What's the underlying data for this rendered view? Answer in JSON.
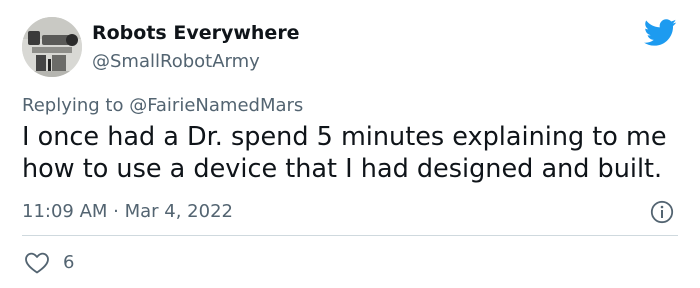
{
  "author": {
    "display_name": "Robots Everywhere",
    "handle": "@SmallRobotArmy",
    "avatar_icon": "robot-photo-avatar"
  },
  "reply": {
    "prefix": "Replying to ",
    "mention": "@FairieNamedMars"
  },
  "tweet": {
    "text": "I once had a Dr. spend 5 minutes explaining to me how to use a device that I had designed and built.",
    "timestamp": "11:09 AM · Mar 4, 2022"
  },
  "actions": {
    "like_count": "6",
    "like_icon": "heart-icon",
    "info_icon": "info-icon"
  },
  "brand": {
    "logo_icon": "twitter-bird-icon",
    "accent_color": "#1d9bf0",
    "secondary_text_color": "#536471",
    "primary_text_color": "#0f1419"
  }
}
